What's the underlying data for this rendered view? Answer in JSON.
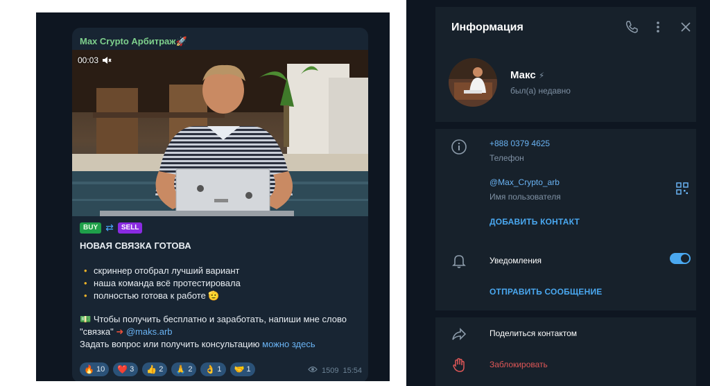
{
  "post": {
    "channel_name": "Max Crypto Арбитраж🚀",
    "video_time": "00:03",
    "badge_buy": "BUY",
    "badge_sell": "SELL",
    "headline": "НОВАЯ СВЯЗКА ГОТОВА",
    "bullets": [
      "скриннер отобрал лучший вариант",
      "наша команда всё протестировала",
      "полностью готова к работе 🫡"
    ],
    "cta_line1": "Чтобы получить бесплатно и заработать, напиши мне слово",
    "cta_word": "\"связка\"",
    "cta_handle": "@maks.arb",
    "cta_line2_prefix": "Задать вопрос или получить консультацию",
    "cta_line2_link": "можно здесь",
    "reactions": [
      {
        "emoji": "🔥",
        "count": "10"
      },
      {
        "emoji": "❤️",
        "count": "3"
      },
      {
        "emoji": "👍",
        "count": "2"
      },
      {
        "emoji": "🙏",
        "count": "2"
      },
      {
        "emoji": "👌",
        "count": "1"
      },
      {
        "emoji": "🤝",
        "count": "1"
      }
    ],
    "views": "1509",
    "time": "15:54"
  },
  "info": {
    "title": "Информация",
    "name": "Макс",
    "status": "был(а) недавно",
    "phone": "+888 0379 4625",
    "phone_label": "Телефон",
    "username": "@Max_Crypto_arb",
    "username_label": "Имя пользователя",
    "add_contact": "ДОБАВИТЬ КОНТАКТ",
    "notifications": "Уведомления",
    "notifications_on": true,
    "send_message": "ОТПРАВИТЬ СООБЩЕНИЕ",
    "share_contact": "Поделиться контактом",
    "block": "Заблокировать"
  },
  "colors": {
    "accent": "#4aa8f0",
    "danger": "#e05757",
    "panel_bg": "#17212b",
    "channel_name": "#7ed08c"
  }
}
